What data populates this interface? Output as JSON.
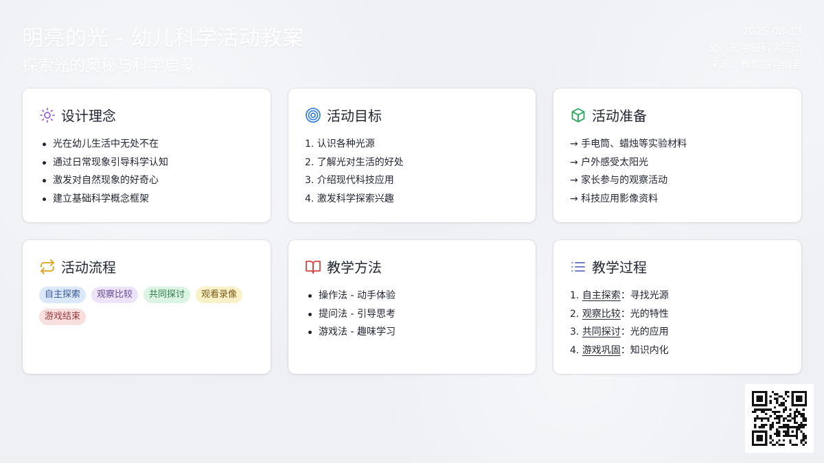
{
  "header": {
    "title": "明亮的光 - 幼儿科学活动教案",
    "subtitle": "探索光的奥秘与科学启蒙",
    "date": "2025-08-13",
    "category": "幼儿园中班科学活动",
    "source": "来源：教育指导纲要"
  },
  "cards": {
    "design": {
      "icon": "sun-icon",
      "title": "设计理念",
      "items": [
        "光在幼儿生活中无处不在",
        "通过日常现象引导科学认知",
        "激发对自然现象的好奇心",
        "建立基础科学概念框架"
      ]
    },
    "goals": {
      "icon": "target-icon",
      "title": "活动目标",
      "items": [
        "1. 认识各种光源",
        "2. 了解光对生活的好处",
        "3. 介绍现代科技应用",
        "4. 激发科学探索兴趣"
      ]
    },
    "prep": {
      "icon": "cube-icon",
      "title": "活动准备",
      "items": [
        "→ 手电筒、蜡烛等实验材料",
        "→ 户外感受太阳光",
        "→ 家长参与的观察活动",
        "→ 科技应用影像资料"
      ]
    },
    "flow": {
      "icon": "repeat-icon",
      "title": "活动流程",
      "tags": [
        "自主探索",
        "观察比较",
        "共同探讨",
        "观看录像",
        "游戏结束"
      ]
    },
    "methods": {
      "icon": "book-icon",
      "title": "教学方法",
      "items": [
        "操作法 - 动手体验",
        "提问法 - 引导思考",
        "游戏法 - 趣味学习"
      ]
    },
    "process": {
      "icon": "list-icon",
      "title": "教学过程",
      "steps": [
        {
          "num": "1.",
          "term": "自主探索",
          "desc": "：寻找光源"
        },
        {
          "num": "2.",
          "term": "观察比较",
          "desc": "：光的特性"
        },
        {
          "num": "3.",
          "term": "共同探讨",
          "desc": "：光的应用"
        },
        {
          "num": "4.",
          "term": "游戏巩固",
          "desc": "：知识内化"
        }
      ]
    }
  },
  "colors": {
    "sun": "#9b5fd6",
    "target": "#3b82d6",
    "cube": "#22a55a",
    "repeat": "#e0a21a",
    "book": "#d9453d",
    "list": "#5b6bc4",
    "tag_bg": [
      "#dbe7fb",
      "#ede3fb",
      "#dcf4e3",
      "#fbf1c8",
      "#fbdede"
    ],
    "tag_fg": [
      "#3a5a9a",
      "#6a4a9a",
      "#2f7a4a",
      "#7a5a1a",
      "#9a3a3a"
    ]
  }
}
